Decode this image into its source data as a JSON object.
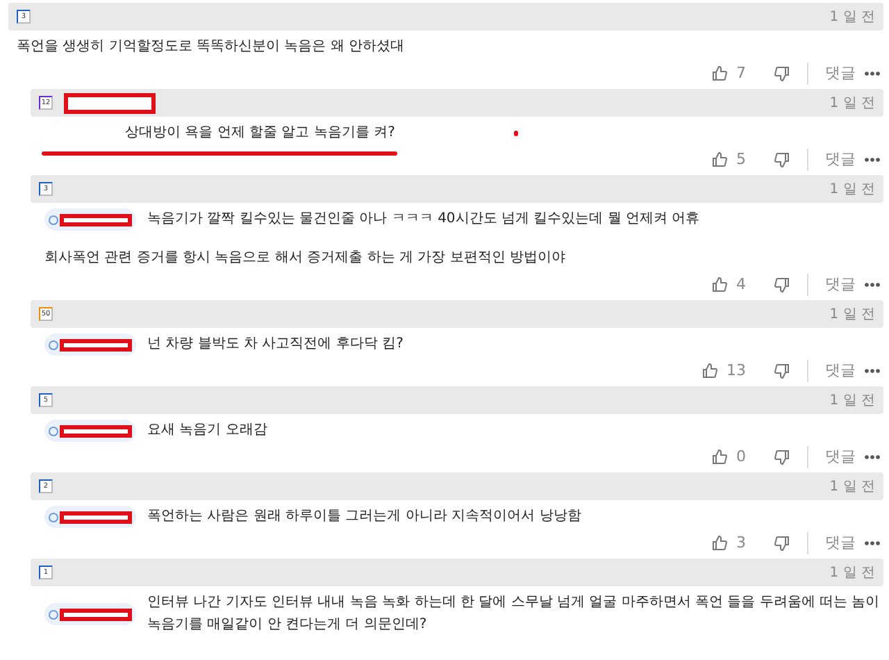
{
  "comments": [
    {
      "level": "3",
      "color": "#1f5fbf",
      "name_redacted": false,
      "time": "1 일 전",
      "paragraphs": [
        "폭언을 생생히 기억할정도로 똑똑하신분이 녹음은 왜 안하셨대"
      ],
      "reply": false,
      "likes": "7",
      "reply_label": "댓글"
    },
    {
      "level": "12",
      "color": "#6a2bd9",
      "name_redacted": true,
      "time": "1 일 전",
      "mention": false,
      "paragraphs": [
        "상대방이 욕을 언제 할줄 알고 녹음기를 켜?"
      ],
      "reply": true,
      "underlined": true,
      "likes": "5",
      "reply_label": "댓글"
    },
    {
      "level": "3",
      "color": "#1f5fbf",
      "name_redacted": false,
      "time": "1 일 전",
      "mention": true,
      "paragraphs": [
        "녹음기가 깔짝 킬수있는 물건인줄 아나 ㅋㅋㅋ 40시간도 넘게 킬수있는데 뭘 언제켜 어휴",
        "회사폭언 관련 증거를 항시 녹음으로 해서 증거제출 하는 게 가장 보편적인 방법이야"
      ],
      "reply": true,
      "underlined": false,
      "likes": "4",
      "reply_label": "댓글"
    },
    {
      "level": "50",
      "color": "#e8900c",
      "name_redacted": false,
      "time": "1 일 전",
      "mention": true,
      "paragraphs": [
        "넌 차량 블박도 차 사고직전에 후다닥 킴?"
      ],
      "reply": true,
      "underlined": false,
      "likes": "13",
      "reply_label": "댓글"
    },
    {
      "level": "5",
      "color": "#1f5fbf",
      "name_redacted": false,
      "time": "1 일 전",
      "mention": true,
      "paragraphs": [
        "요새 녹음기 오래감"
      ],
      "reply": true,
      "underlined": false,
      "likes": "0",
      "reply_label": "댓글"
    },
    {
      "level": "2",
      "color": "#1f5fbf",
      "name_redacted": false,
      "time": "1 일 전",
      "mention": true,
      "paragraphs": [
        "폭언하는 사람은 원래 하루이틀 그러는게 아니라 지속적이어서 낭낭함"
      ],
      "reply": true,
      "underlined": false,
      "likes": "3",
      "reply_label": "댓글"
    },
    {
      "level": "1",
      "color": "#1f5fbf",
      "name_redacted": false,
      "time": "1 일 전",
      "mention": true,
      "paragraphs": [
        "인터뷰 나간 기자도 인터뷰 내내 녹음 녹화 하는데 한 달에 스무날 넘게 얼굴 마주하면서 폭언 들을 두려움에 떠는 놈이 녹음기를 매일같이 안 켠다는게 더 의문인데?"
      ],
      "reply": true,
      "underlined": false
    }
  ]
}
